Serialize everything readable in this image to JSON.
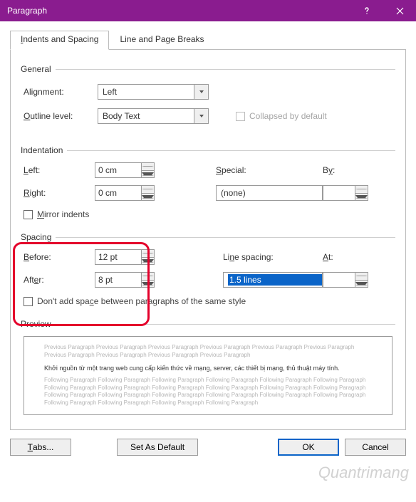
{
  "title": "Paragraph",
  "tabs": {
    "t0": "ndents and Spacing",
    "t1": "ine and Page Breaks"
  },
  "general": {
    "legend": "General",
    "alignment_label": "lignment:",
    "alignment_val": "Left",
    "outline_label": "utline level:",
    "outline_val": "Body Text",
    "collapsed": "Collapsed by default"
  },
  "indent": {
    "legend": "Indentation",
    "left_l": "eft:",
    "left_v": "0 cm",
    "right_l": "ight:",
    "right_v": "0 cm",
    "special_l": "pecial:",
    "special_v": "(none)",
    "by_l": "y:",
    "by_v": "",
    "mirror": "irror indents"
  },
  "spacing": {
    "legend": "Spacing",
    "before_l": "efore:",
    "before_v": "12 pt",
    "after_l": "Aft",
    "after_l2": "r:",
    "after_v": "8 pt",
    "line_l": "e spacing:",
    "line_v": "1.5 lines",
    "at_l": "t:",
    "at_v": "",
    "noadd": "Don't add spa",
    "noadd2": "e between paragraphs of the same style"
  },
  "preview": {
    "legend": "Preview",
    "prev": "Previous Paragraph Previous Paragraph Previous Paragraph Previous Paragraph Previous Paragraph Previous Paragraph Previous Paragraph Previous Paragraph Previous Paragraph Previous Paragraph",
    "main": "Khởi nguồn từ một trang web cung cấp kiến thức về mạng, server, các thiết bị mạng, thủ thuật máy tính.",
    "foll": "Following Paragraph Following Paragraph Following Paragraph Following Paragraph Following Paragraph Following Paragraph Following Paragraph Following Paragraph Following Paragraph Following Paragraph Following Paragraph Following Paragraph Following Paragraph Following Paragraph Following Paragraph Following Paragraph Following Paragraph Following Paragraph Following Paragraph Following Paragraph Following Paragraph Following Paragraph"
  },
  "buttons": {
    "tabs": "abs...",
    "def": "et As Default",
    "ok": "OK",
    "cancel": "Cancel"
  },
  "watermark": "Quantrimang"
}
